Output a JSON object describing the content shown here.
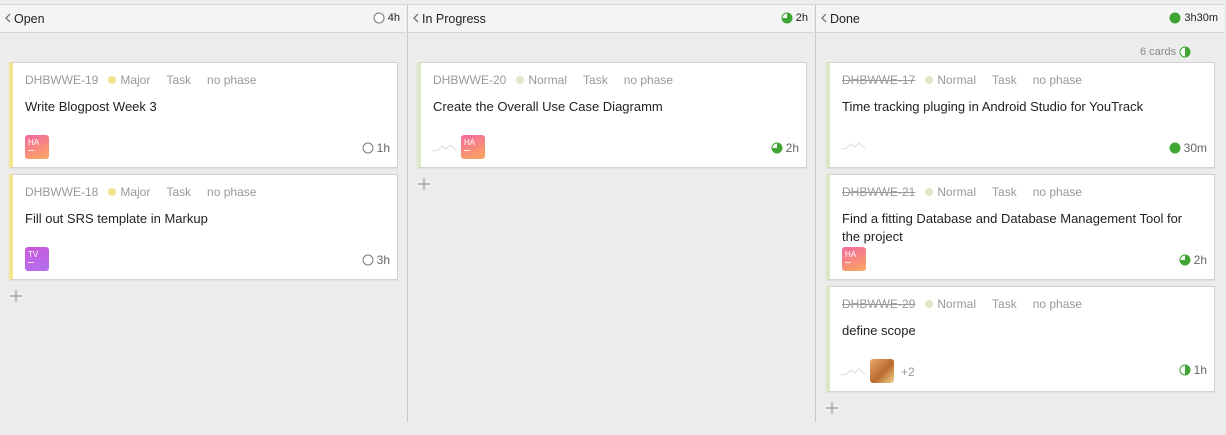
{
  "columns": [
    {
      "name": "Open",
      "total": "4h",
      "total_state": "empty"
    },
    {
      "name": "In Progress",
      "total": "2h",
      "total_state": "three-quarter"
    },
    {
      "name": "Done",
      "total": "3h30m",
      "total_state": "full"
    }
  ],
  "done_cards_count": "6 cards",
  "cards": {
    "c19": {
      "id": "DHBWWE-19",
      "priority": "Major",
      "type": "Task",
      "phase": "no phase",
      "title": "Write Blogpost Week 3",
      "avatar": "HA",
      "estimate": "1h"
    },
    "c18": {
      "id": "DHBWWE-18",
      "priority": "Major",
      "type": "Task",
      "phase": "no phase",
      "title": "Fill out SRS template in Markup",
      "avatar": "TV",
      "estimate": "3h"
    },
    "c20": {
      "id": "DHBWWE-20",
      "priority": "Normal",
      "type": "Task",
      "phase": "no phase",
      "title": "Create the Overall Use Case Diagramm",
      "avatar": "HA",
      "estimate": "2h"
    },
    "c17": {
      "id": "DHBWWE-17",
      "priority": "Normal",
      "type": "Task",
      "phase": "no phase",
      "title": "Time tracking pluging in Android Studio for YouTrack",
      "estimate": "30m"
    },
    "c21": {
      "id": "DHBWWE-21",
      "priority": "Normal",
      "type": "Task",
      "phase": "no phase",
      "title": "Find a fitting Database and Database Management Tool for the project",
      "avatar": "HA",
      "estimate": "2h"
    },
    "c29": {
      "id": "DHBWWE-29",
      "priority": "Normal",
      "type": "Task",
      "phase": "no phase",
      "title": "define scope",
      "extra_assignees": "+2",
      "estimate": "1h"
    }
  },
  "colors": {
    "major": "#f3e48d",
    "normal": "#dde9c6",
    "progress_green": "#3fa535"
  }
}
